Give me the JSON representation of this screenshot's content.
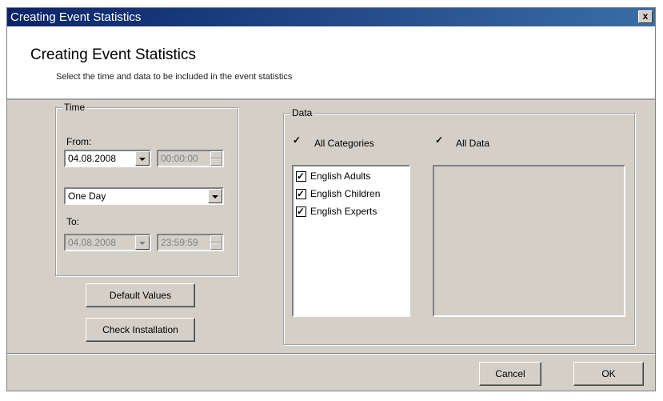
{
  "window": {
    "title": "Creating Event Statistics",
    "close_label": "x"
  },
  "header": {
    "title": "Creating Event Statistics",
    "subtitle": "Select the time and data to be included in the event statistics"
  },
  "time": {
    "group_label": "Time",
    "from_label": "From:",
    "from_date": "04.08.2008",
    "from_time": "00:00:00",
    "period": "One Day",
    "to_label": "To:",
    "to_date": "04.08.2008",
    "to_time": "23:59:59"
  },
  "buttons": {
    "default_values": "Default Values",
    "check_installation": "Check Installation",
    "cancel": "Cancel",
    "ok": "OK"
  },
  "data": {
    "group_label": "Data",
    "all_categories_label": "All Categories",
    "all_categories_checked": true,
    "all_data_label": "All Data",
    "all_data_checked": true,
    "categories": [
      {
        "label": "English Adults",
        "checked": true
      },
      {
        "label": "English Children",
        "checked": true
      },
      {
        "label": "English Experts",
        "checked": true
      }
    ],
    "check_mark": "✓"
  }
}
